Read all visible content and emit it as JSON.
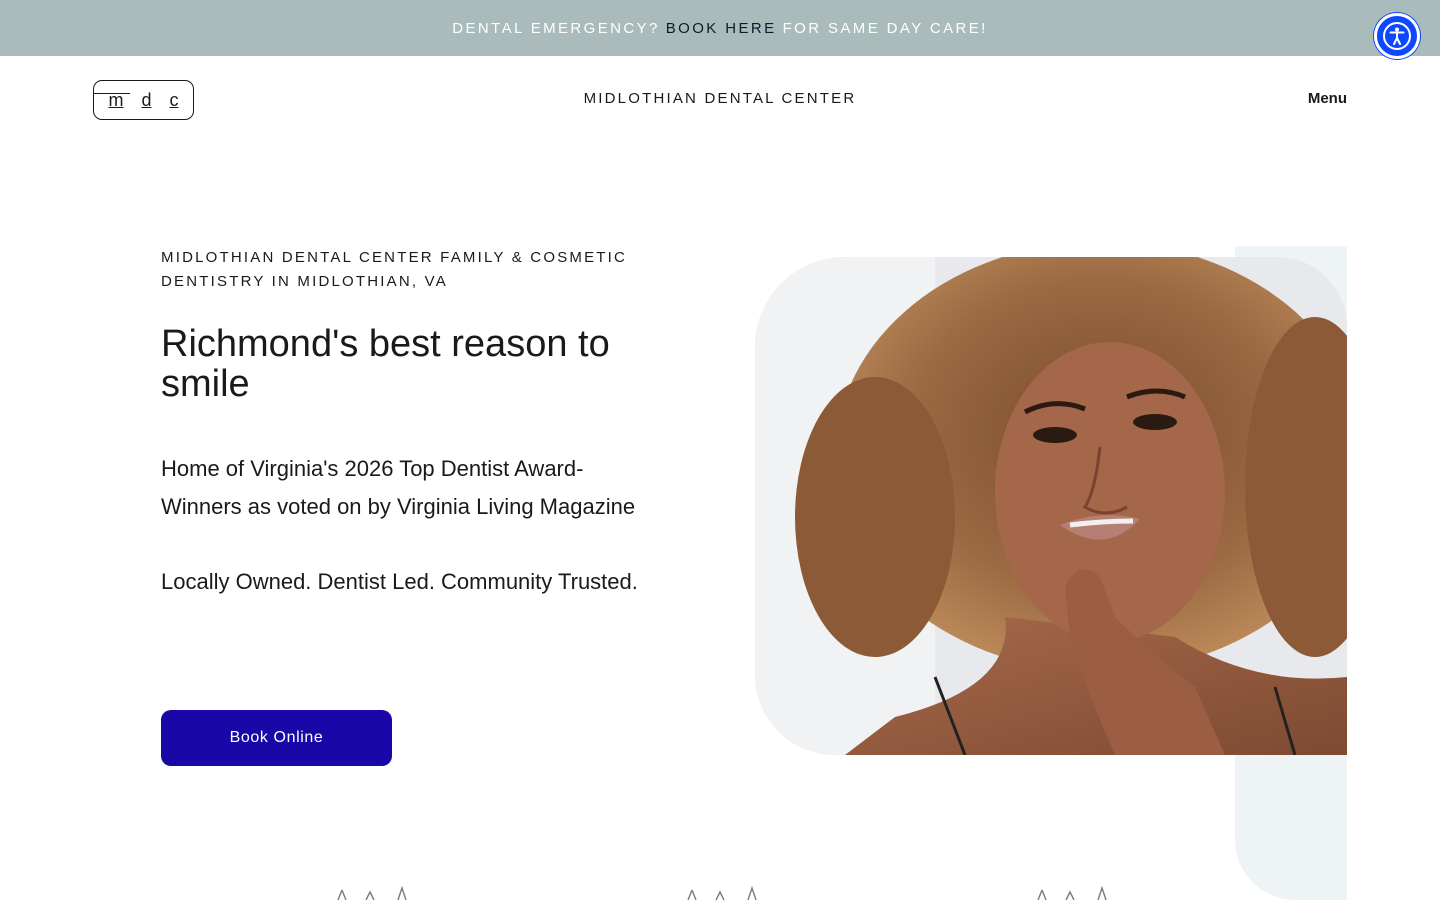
{
  "announcement": {
    "prefix": "DENTAL EMERGENCY?",
    "link_book": "BOOK",
    "link_here": "HERE",
    "suffix": "FOR SAME DAY CARE!"
  },
  "accessibility": {
    "icon": "accessibility-person-icon"
  },
  "header": {
    "logo": {
      "letters": [
        "m",
        "d",
        "c"
      ]
    },
    "site_title": "MIDLOTHIAN DENTAL CENTER",
    "menu_label": "Menu"
  },
  "hero": {
    "eyebrow": "MIDLOTHIAN DENTAL CENTER FAMILY & COSMETIC DENTISTRY IN MIDLOTHIAN, VA",
    "headline": "Richmond's best reason to smile",
    "paragraph_1": "Home of Virginia's 2026 Top Dentist Award-Winners as voted on by Virginia Living Magazine",
    "paragraph_2": "Locally Owned. Dentist Led. Community Trusted.",
    "cta_label": "Book Online"
  },
  "colors": {
    "announcement_bg": "#a9bcbb",
    "cta_bg": "#1a07a8",
    "accessibility_bg": "#0d47ff",
    "panel_bg": "#eef3f6"
  }
}
